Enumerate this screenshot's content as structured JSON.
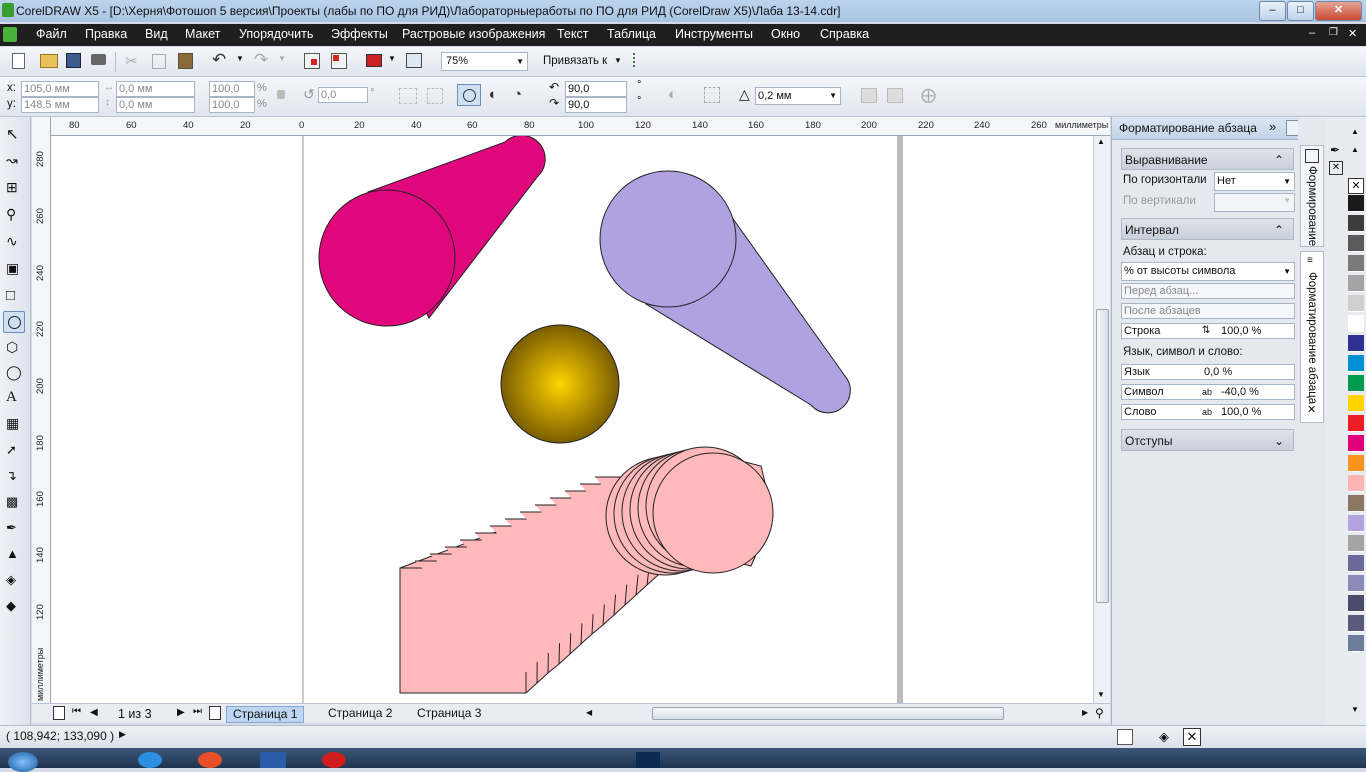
{
  "window": {
    "title": "CorelDRAW X5 - [D:\\Херня\\Фотошоп 5 версия\\Проекты (лабы по ПО для РИД)\\Лабораторныеработы по ПО для РИД (CorelDraw X5)\\Лаба 13-14.cdr]"
  },
  "menu": [
    "Файл",
    "Правка",
    "Вид",
    "Макет",
    "Упорядочить",
    "Эффекты",
    "Растровые изображения",
    "Текст",
    "Таблица",
    "Инструменты",
    "Окно",
    "Справка"
  ],
  "toolbar": {
    "zoom": "75%",
    "snap": "Привязать к"
  },
  "propbar": {
    "x_label": "x:",
    "x": "105,0 мм",
    "y_label": "y:",
    "y": "148,5 мм",
    "w": "0,0 мм",
    "h": "0,0 мм",
    "scale_w": "100,0",
    "scale_h": "100,0",
    "pct": "%",
    "rotation": "0,0",
    "angle_start": "90,0",
    "angle_end": "90,0",
    "deg": "°",
    "outline": "0,2 мм"
  },
  "ruler": {
    "units": "миллиметры",
    "h_ticks": [
      "80",
      "60",
      "40",
      "20",
      "0",
      "20",
      "40",
      "60",
      "80",
      "100",
      "120",
      "140",
      "160",
      "180",
      "200",
      "220",
      "240",
      "260"
    ],
    "v_ticks": [
      "280",
      "260",
      "240",
      "220",
      "200",
      "180",
      "160",
      "140",
      "120"
    ]
  },
  "pages": {
    "counter": "1 из 3",
    "tabs": [
      "Страница 1",
      "Страница 2",
      "Страница 3"
    ]
  },
  "docker": {
    "title": "Форматирование абзаца",
    "align": {
      "header": "Выравнивание",
      "horiz_label": "По горизонтали",
      "horiz_value": "Нет",
      "vert_label": "По вертикали"
    },
    "spacing": {
      "header": "Интервал",
      "para_line": "Абзац и строка:",
      "unit": "% от высоты символа",
      "before": "Перед абзац...",
      "after": "После абзацев",
      "line_label": "Строка",
      "line_value": "100,0 %",
      "lang_header": "Язык, символ и слово:",
      "lang_label": "Язык",
      "lang_value": "0,0 %",
      "char_label": "Символ",
      "char_value": "-40,0 %",
      "word_label": "Слово",
      "word_value": "100,0 %"
    },
    "indents": "Отступы"
  },
  "sidetabs": [
    "Формирование",
    "Форматирование абзаца"
  ],
  "palette": [
    "#1a1a1a",
    "#3d3d3d",
    "#5a5a5a",
    "#7a7a7a",
    "#a4a4a4",
    "#cfcfcf",
    "#ffffff",
    "#2e3192",
    "#0090d4",
    "#009a4e",
    "#ffd400",
    "#ee1c24",
    "#e0007a",
    "#f7941d",
    "#ffb3b3",
    "#8c7763",
    "#b3a3e0",
    "#a4a4a4",
    "#6b6b9a",
    "#8b8bb8",
    "#4a4a6a",
    "#5a5a7a",
    "#6b7d9a"
  ],
  "status": {
    "coords": "( 108,942; 133,090 )"
  },
  "colors": {
    "magenta": "#e0077d",
    "lavender": "#b0a2e1",
    "pink": "#ffb9ba",
    "gold": "#ffd400",
    "goldDark": "#7a5d00"
  }
}
